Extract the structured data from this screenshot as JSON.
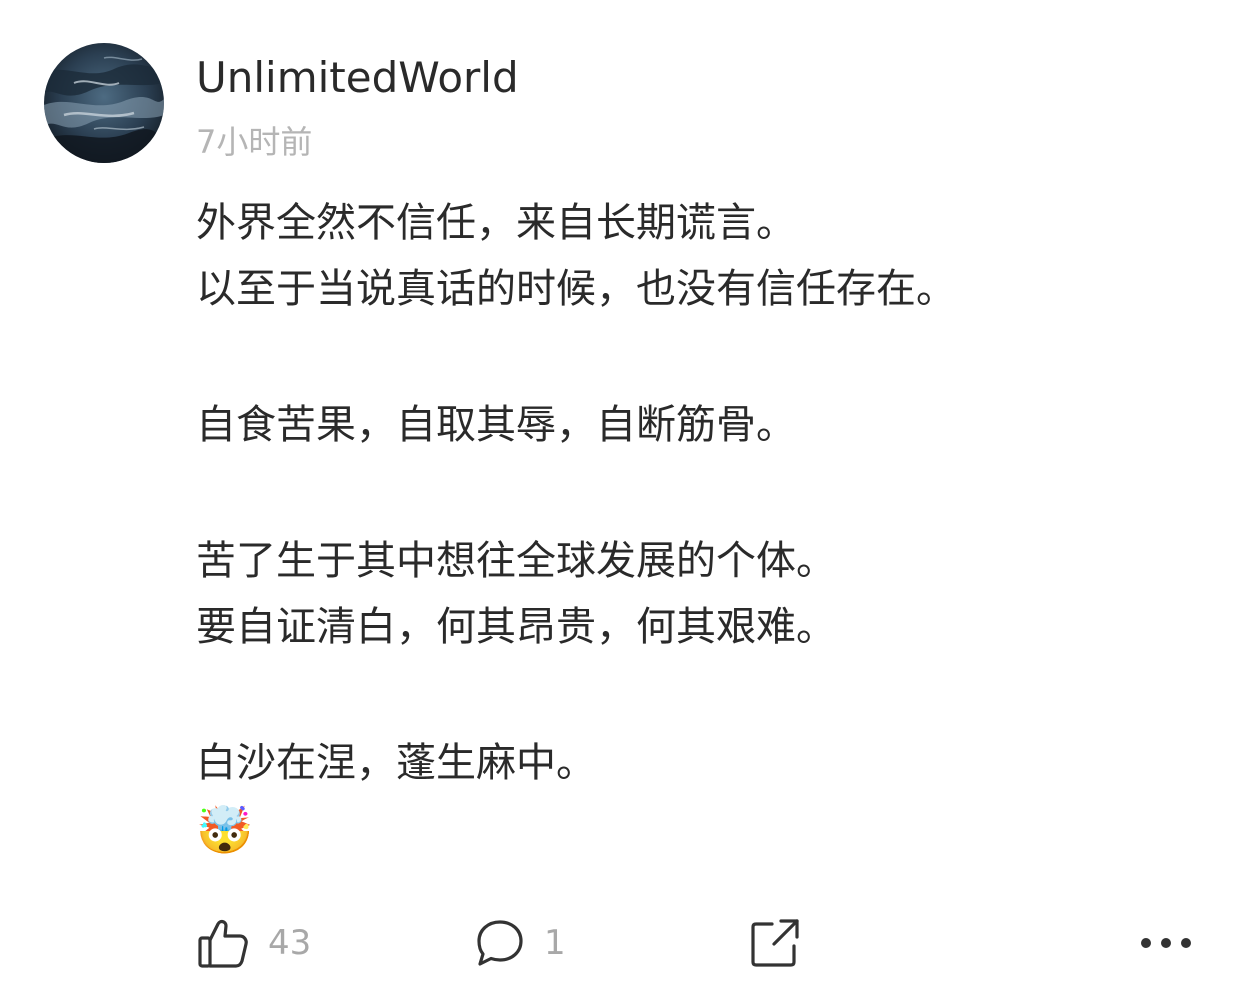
{
  "post": {
    "author": "UnlimitedWorld",
    "time": "7小时前",
    "lines": [
      "外界全然不信任，来自长期谎言。",
      "以至于当说真话的时候，也没有信任存在。",
      "",
      "自食苦果，自取其辱，自断筋骨。",
      "",
      "苦了生于其中想往全球发展的个体。",
      "要自证清白，何其昂贵，何其艰难。",
      "",
      "白沙在涅，蓬生麻中。"
    ],
    "emoji": "🤯"
  },
  "actions": {
    "like_count": "43",
    "comment_count": "1",
    "like_icon": "thumbs-up-icon",
    "comment_icon": "comment-bubble-icon",
    "share_icon": "share-icon",
    "more_icon": "more-dots-icon"
  }
}
